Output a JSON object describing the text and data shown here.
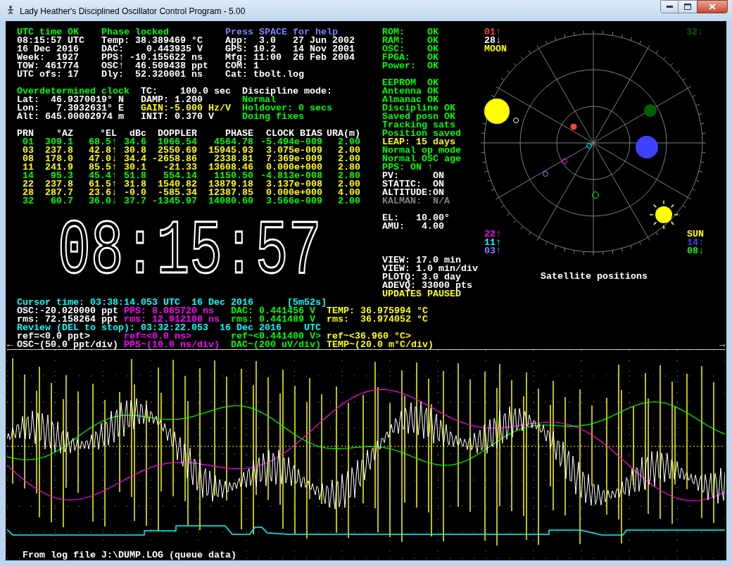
{
  "window": {
    "title": "Lady Heather's Disciplined Oscillator Control Program - 5.00"
  },
  "header_block": [
    {
      "lines": [
        {
          "text": "UTC time OK",
          "color": "#00ff00"
        },
        {
          "text": "08:15:57 UTC",
          "color": "#ffffff"
        },
        {
          "text": "16 Dec 2016",
          "color": "#ffffff"
        },
        {
          "text": "Week:  1927",
          "color": "#ffffff"
        },
        {
          "text": "TOW: 461774",
          "color": "#ffffff"
        },
        {
          "text": "UTC ofs: 17",
          "color": "#ffffff"
        }
      ]
    },
    {
      "lines": [
        {
          "text": "Phase locked",
          "color": "#00ff00"
        },
        {
          "text": "Temp: 38.389469 °C",
          "color": "#ffffff"
        },
        {
          "text": "DAC:    0.443935 V",
          "color": "#ffffff"
        },
        {
          "text": "PPS↑ -10.155622 ns",
          "color": "#ffffff"
        },
        {
          "text": "OSC↑  46.509438 ppt",
          "color": "#ffffff"
        },
        {
          "text": "Dly:  52.320001 ns",
          "color": "#ffffff"
        }
      ]
    },
    {
      "lines": [
        {
          "text": "Press SPACE for help",
          "color": "#8080ff"
        },
        {
          "text": "App:  3.0   27 Jun 2002",
          "color": "#ffffff"
        },
        {
          "text": "GPS: 10.2   14 Nov 2001",
          "color": "#ffffff"
        },
        {
          "text": "Mfg: 11:00  26 Feb 2004",
          "color": "#ffffff"
        },
        {
          "text": "COM: 1",
          "color": "#ffffff"
        },
        {
          "text": "Cat: tbolt.log",
          "color": "#ffffff"
        }
      ]
    }
  ],
  "discipline_block": [
    {
      "lines": [
        {
          "text": "Overdetermined clock",
          "color": "#00ff00"
        },
        {
          "text": "Lat:  46.9370019° N",
          "color": "#ffffff"
        },
        {
          "text": "Lon:   7.3932631° E",
          "color": "#ffffff"
        },
        {
          "text": "Alt: 645.00002974 m",
          "color": "#ffffff"
        }
      ]
    },
    {
      "lines": [
        {
          "text": "TC:    100.0 sec",
          "color": "#ffffff"
        },
        {
          "text": "DAMP: 1.200",
          "color": "#ffffff"
        },
        {
          "text": "GAIN:-5.000 Hz/V",
          "color": "#ffff00"
        },
        {
          "text": "INIT: 0.370 V",
          "color": "#ffffff"
        }
      ]
    },
    {
      "lines": [
        {
          "text": "Discipline mode:",
          "color": "#ffffff"
        },
        {
          "text": "Normal",
          "color": "#00ff00"
        },
        {
          "text": "Holdover: 0 secs",
          "color": "#00ff00"
        },
        {
          "text": "Doing fixes",
          "color": "#00ff00"
        }
      ]
    }
  ],
  "satellite_table": {
    "columns": [
      "PRN",
      "°AZ",
      "°EL",
      "dBc",
      "DOPPLER",
      "PHASE",
      "CLOCK BIAS",
      "URA(m)"
    ],
    "rows": [
      {
        "color": "#00ff00",
        "cells": [
          "01",
          "309.1",
          "68.5↑",
          "34.6",
          "1066.54",
          "4564.78",
          "-5.494e-009",
          "2.00"
        ]
      },
      {
        "color": "#ffff00",
        "cells": [
          "03",
          "237.8",
          "42.8↑",
          "30.8",
          "2550.69",
          "15945.93",
          "3.075e-009",
          "2.00"
        ]
      },
      {
        "color": "#ffff00",
        "cells": [
          "08",
          "178.0",
          "47.0↓",
          "34.4",
          "-2658.86",
          "2338.81",
          "7.369e-009",
          "2.00"
        ]
      },
      {
        "color": "#ffff00",
        "cells": [
          "11",
          "241.9",
          "85.5↑",
          "30.1",
          "-21.33",
          "13608.46",
          "0.000e+000",
          "2.80"
        ]
      },
      {
        "color": "#00ff00",
        "cells": [
          "14",
          "95.3",
          "45.4↑",
          "51.8",
          "554.14",
          "1150.50",
          "-4.813e-008",
          "2.80"
        ]
      },
      {
        "color": "#ffff00",
        "cells": [
          "22",
          "237.8",
          "61.5↑",
          "31.8",
          "1540.82",
          "13879.18",
          "3.137e-008",
          "2.00"
        ]
      },
      {
        "color": "#ffff00",
        "cells": [
          "28",
          "287.7",
          "23.6↓",
          "-0.0",
          "-585.34",
          "12387.85",
          "0.000e+000",
          "4.00"
        ]
      },
      {
        "color": "#00ff00",
        "cells": [
          "32",
          "60.7",
          "36.0↓",
          "37.7",
          "-1345.97",
          "14080.60",
          "3.566e-009",
          "2.00"
        ]
      }
    ]
  },
  "clock": {
    "time": "08:15:57"
  },
  "health_blocks": [
    [
      {
        "text": "ROM:    OK",
        "color": "#00ff00"
      },
      {
        "text": "RAM:    OK",
        "color": "#00ff00"
      },
      {
        "text": "OSC:    OK",
        "color": "#00ff00"
      },
      {
        "text": "FPGA:   OK",
        "color": "#00ff00"
      },
      {
        "text": "Power:  OK",
        "color": "#00ff00"
      }
    ],
    [
      {
        "text": "EEPROM  OK",
        "color": "#00ff00"
      },
      {
        "text": "Antenna OK",
        "color": "#00ff00"
      },
      {
        "text": "Almanac OK",
        "color": "#00ff00"
      },
      {
        "text": "Discipline OK",
        "color": "#00ff00"
      },
      {
        "text": "Saved posn OK",
        "color": "#00ff00"
      },
      {
        "text": "Tracking sats",
        "color": "#00ff00"
      },
      {
        "text": "Position saved",
        "color": "#00ff00"
      },
      {
        "text": "LEAP: 15 days",
        "color": "#ffff00"
      },
      {
        "text": "Normal op mode",
        "color": "#00ff00"
      },
      {
        "text": "Normal OSC age",
        "color": "#00ff00"
      },
      {
        "text": "PPS: ON ↑",
        "color": "#00ff00"
      },
      {
        "text": "PV:      ON",
        "color": "#ffffff"
      },
      {
        "text": "STATIC:  ON",
        "color": "#ffffff"
      },
      {
        "text": "ALTITUDE:ON",
        "color": "#ffffff"
      },
      {
        "text": "KALMAN:  N/A",
        "color": "#808080"
      }
    ],
    [
      {
        "text": "EL:   10.00°",
        "color": "#ffffff"
      },
      {
        "text": "AMU:   4.00",
        "color": "#ffffff"
      }
    ]
  ],
  "plot_info": [
    {
      "text": "VIEW: 17.0 min",
      "color": "#ffffff"
    },
    {
      "text": "VIEW: 1.0 min/div",
      "color": "#ffffff"
    },
    {
      "text": "PLOTQ: 3.0 day",
      "color": "#ffffff"
    },
    {
      "text": "ADEVQ: 33000 pts",
      "color": "#ffffff"
    },
    {
      "text": "UPDATES PAUSED",
      "color": "#ffff00"
    }
  ],
  "sky": {
    "title": "Satellite positions",
    "labels_top_left": [
      {
        "text": "01↑",
        "color": "#ff4040"
      },
      {
        "text": "28↓",
        "color": "#ffffff"
      },
      {
        "text": "MOON",
        "color": "#ffff00"
      }
    ],
    "labels_top_right": [
      {
        "text": "32↓",
        "color": "#006000"
      }
    ],
    "labels_bottom_left": [
      {
        "text": "22↑",
        "color": "#ff00ff"
      },
      {
        "text": "11↑",
        "color": "#00ffff"
      },
      {
        "text": "03↑",
        "color": "#8080ff"
      }
    ],
    "labels_bottom_right": [
      {
        "text": "SUN",
        "color": "#ffff00"
      },
      {
        "text": "14↑",
        "color": "#4040ff"
      },
      {
        "text": "08↓",
        "color": "#00ff00"
      }
    ]
  },
  "readouts": [
    {
      "segments": [
        {
          "text": "Cursor time: 03:38:14.053 UTC  16 Dec 2016      [5m52s]",
          "color": "#00ffff"
        }
      ]
    },
    {
      "segments": [
        {
          "text": "OSC:-20.020000 ppt",
          "color": "#ffffff"
        },
        {
          "text": "PPS: 8.085720 ns",
          "color": "#ff00ff"
        },
        {
          "text": "DAC: 0.441456 V",
          "color": "#00ff00"
        },
        {
          "text": "TEMP: 36.975994 °C",
          "color": "#ffff00"
        }
      ]
    },
    {
      "segments": [
        {
          "text": "rms: 72.158264 ppt",
          "color": "#ffffff"
        },
        {
          "text": "rms: 12.912108 ns",
          "color": "#ff00ff"
        },
        {
          "text": "rms: 0.441489 V",
          "color": "#00ff00"
        },
        {
          "text": "rms:  36.974052 °C",
          "color": "#ffff00"
        }
      ]
    },
    {
      "segments": [
        {
          "text": "Review (DEL to stop): 03:32:22.053  16 Dec 2016    UTC",
          "color": "#00ffff"
        }
      ]
    },
    {
      "segments": [
        {
          "text": "ref=<0.0 ppt>",
          "color": "#ffffff"
        },
        {
          "text": "ref=<0.0 ns>",
          "color": "#ff00ff"
        },
        {
          "text": "ref~<0.441400 V>",
          "color": "#00ff00"
        },
        {
          "text": "ref~<36.960 °C>",
          "color": "#ffff00"
        }
      ]
    },
    {
      "left_marker": "←",
      "right_marker": "→",
      "segments": [
        {
          "text": "OSC~(50.0 ppt/div)",
          "color": "#ffffff"
        },
        {
          "text": "PPS~(10.0 ns/div)",
          "color": "#ff00ff"
        },
        {
          "text": "DAC~(200 uV/div)",
          "color": "#00ff00"
        },
        {
          "text": "TEMP~(20.0 m°C/div)",
          "color": "#ffff00"
        }
      ]
    }
  ],
  "footer": "From log file J:\\DUMP.LOG (queue data)"
}
